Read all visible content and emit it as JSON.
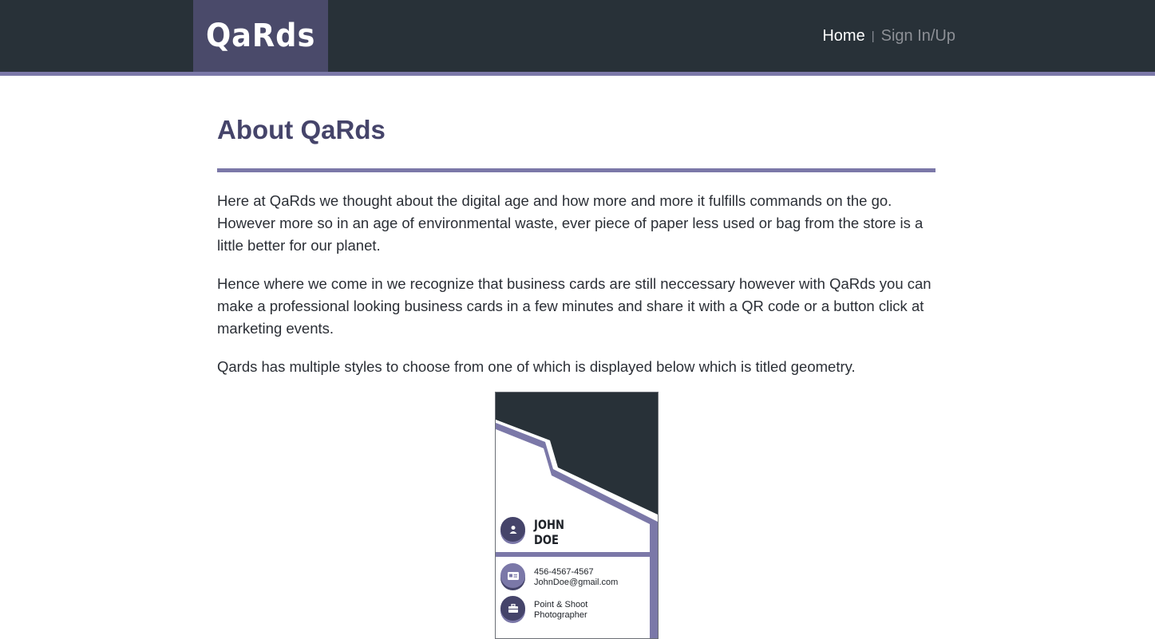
{
  "header": {
    "logo": "QaRds",
    "nav": {
      "home": "Home",
      "separator": "|",
      "sign_in": "Sign In/Up"
    }
  },
  "main": {
    "title": "About QaRds",
    "paragraphs": [
      "Here at QaRds we thought about the digital age and how more and more it fulfills commands on the go. However more so in an age of environmental waste, ever piece of paper less used or bag from the store is a little better for our planet.",
      "Hence where we come in we recognize that business cards are still neccessary however with QaRds you can make a professional looking business cards in a few minutes and share it with a QR code or a button click at marketing events.",
      "Qards has multiple styles to choose from one of which is displayed below which is titled geometry."
    ]
  },
  "card": {
    "name_line1": "JOHN",
    "name_line2": "DOE",
    "phone": "456-4567-4567",
    "email": "JohnDoe@gmail.com",
    "job_line1": "Point & Shoot",
    "job_line2": "Photographer",
    "icons": [
      "user-icon",
      "id-card-icon",
      "briefcase-icon"
    ]
  },
  "colors": {
    "header_bg": "#283138",
    "logo_bg": "#4a4a6a",
    "accent": "#7b78a8",
    "title": "#45446a"
  }
}
